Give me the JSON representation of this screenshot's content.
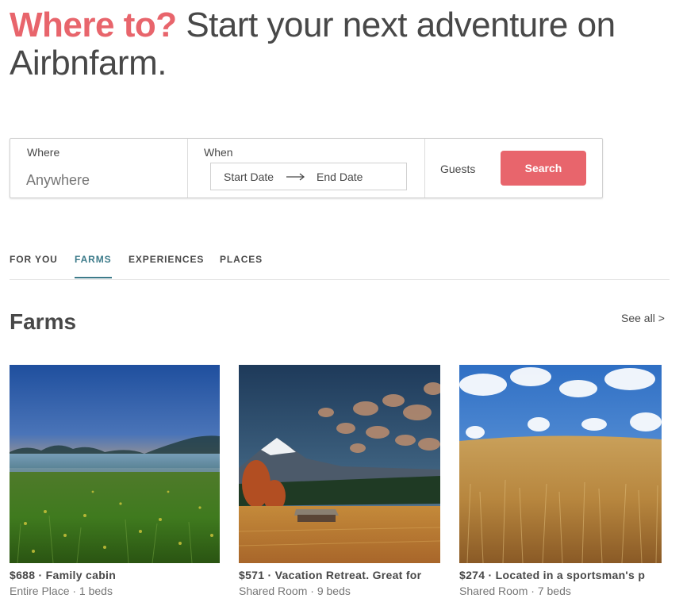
{
  "hero": {
    "accent": "Where to?",
    "text": " Start your next adventure on Airbnfarm."
  },
  "search": {
    "where_label": "Where",
    "where_placeholder": "Anywhere",
    "when_label": "When",
    "start_date": "Start Date",
    "end_date": "End Date",
    "guests_label": "Guests",
    "button_label": "Search"
  },
  "tabs": [
    {
      "label": "FOR YOU",
      "active": false
    },
    {
      "label": "FARMS",
      "active": true
    },
    {
      "label": "EXPERIENCES",
      "active": false
    },
    {
      "label": "PLACES",
      "active": false
    }
  ],
  "section": {
    "title": "Farms",
    "see_all": "See all >"
  },
  "listings": [
    {
      "title": "$688 · Family cabin",
      "subtitle": "Entire Place · 1 beds",
      "image": "misty-meadow-sunrise"
    },
    {
      "title": "$571 · Vacation Retreat. Great for",
      "subtitle": "Shared Room · 9 beds",
      "image": "mountain-barn-autumn"
    },
    {
      "title": "$274 · Located in a sportsman's p",
      "subtitle": "Shared Room · 7 beds",
      "image": "wheat-field-blue-sky"
    }
  ],
  "colors": {
    "accent": "#e8656c",
    "active_tab": "#3d7b8a",
    "text": "#484848",
    "muted": "#767676"
  }
}
